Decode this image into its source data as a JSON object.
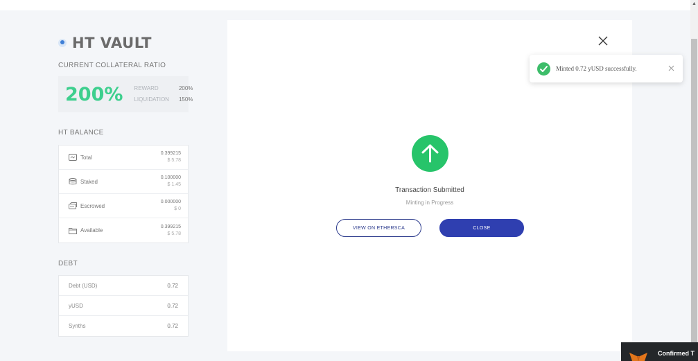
{
  "sidebar": {
    "vault_title": "HT VAULT",
    "collateral_label": "CURRENT COLLATERAL RATIO",
    "ratio": {
      "value": "200%",
      "reward_label": "REWARD",
      "reward_value": "200%",
      "liquidation_label": "LIQUIDATION",
      "liquidation_value": "150%"
    },
    "balance_label": "HT BALANCE",
    "balances": [
      {
        "icon": "wallet-icon",
        "label": "Total",
        "amount": "0.399215",
        "usd": "$ 5.78"
      },
      {
        "icon": "database-icon",
        "label": "Staked",
        "amount": "0.100000",
        "usd": "$ 1.45"
      },
      {
        "icon": "escrow-icon",
        "label": "Escrowed",
        "amount": "0.000000",
        "usd": "$ 0"
      },
      {
        "icon": "folder-icon",
        "label": "Available",
        "amount": "0.399215",
        "usd": "$ 5.78"
      }
    ],
    "debt_label": "DEBT",
    "debts": [
      {
        "label": "Debt (USD)",
        "value": "0.72"
      },
      {
        "label": "yUSD",
        "value": "0.72"
      },
      {
        "label": "Synths",
        "value": "0.72"
      }
    ]
  },
  "modal": {
    "icon": "arrow-up-icon",
    "title": "Transaction Submitted",
    "subtitle": "Minting in Progress",
    "view_button": "VIEW ON ETHERSCA",
    "close_button": "CLOSE"
  },
  "toast": {
    "message": "Minted 0.72 yUSD successfully."
  },
  "metamask": {
    "label": "Confirmed T"
  },
  "colors": {
    "accent_green": "#3ecf8e",
    "success_green": "#27c46a",
    "primary_blue": "#2f3fb0"
  }
}
